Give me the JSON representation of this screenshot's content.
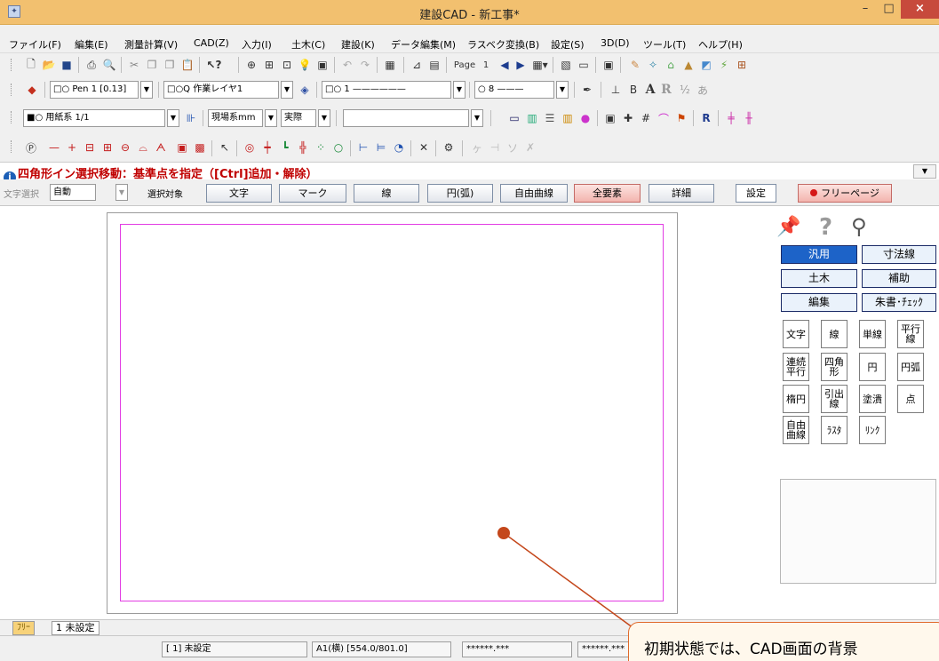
{
  "window": {
    "title": "建設CAD - 新工事*",
    "min": "–",
    "max": "□",
    "close": "×"
  },
  "menu": [
    "ファイル(F)",
    "編集(E)",
    "測量計算(V)",
    "CAD(Z)",
    "入力(I)",
    "土木(C)",
    "建設(K)",
    "データ編集(M)",
    "ラスベク変換(B)",
    "設定(S)",
    "3D(D)",
    "ツール(T)",
    "ヘルプ(H)"
  ],
  "toolbar1": {
    "page_label": "Page",
    "page_value": "1"
  },
  "toolbar2": {
    "pen_combo": "□○ Pen 1 [0.13]",
    "layer_combo": "□○Q 作業レイヤ1",
    "line_combo": "□○ 1 ——————",
    "size_combo": "○ 8 ———",
    "text_a": "A",
    "text_r": "R"
  },
  "toolbar3": {
    "paper_combo": "■○ 用紙系 1/1",
    "unit_combo": "現場系mm",
    "scale_combo": "実際",
    "blank_combo": ""
  },
  "prompt": {
    "text": "四角形イン選択移動：基準点を指定（[Ctrl]追加・解除）"
  },
  "selection": {
    "mode_label": "文字選択",
    "mode_value": "自動",
    "target_label": "選択対象",
    "buttons": [
      "文字",
      "マーク",
      "線",
      "円(弧)",
      "自由曲線",
      "全要素",
      "詳細"
    ],
    "settings": "設定",
    "free_page": "フリーページ"
  },
  "categories": [
    "汎用",
    "寸法線",
    "土木",
    "補助",
    "編集",
    "朱書･ﾁｪｯｸ"
  ],
  "tools": [
    "文字",
    "線",
    "単線",
    "平行線",
    "連続平行",
    "四角形",
    "円",
    "円弧",
    "楕円",
    "引出線",
    "塗潰",
    "点",
    "自由曲線",
    "ﾗｽﾀ",
    "ﾘﾝｸ"
  ],
  "layer_tabs": [
    "ﾌﾘｰ",
    "1 未設定"
  ],
  "status": [
    "[ 1] 未設定",
    "A1(横) [554.0/801.0]",
    "******.***",
    "******.***"
  ],
  "callout": {
    "text": "初期状態では、CAD画面の背景"
  },
  "colors": {
    "title_bar": "#f2c06f",
    "frame": "#e23ce3",
    "accent_blue": "#1d63c8",
    "prompt": "#c00000",
    "pointer": "#c4471b"
  }
}
